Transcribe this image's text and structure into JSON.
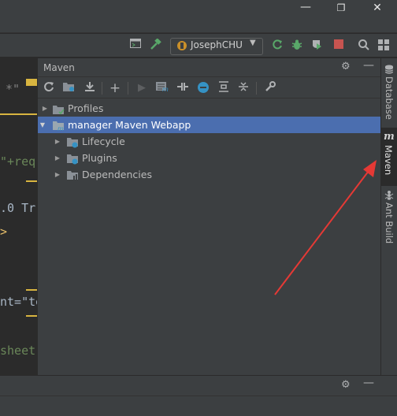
{
  "window": {
    "minimize_icon": "minimize-icon",
    "maximize_icon": "restore-icon",
    "close_icon": "close-icon"
  },
  "toolbar": {
    "run_config": "JosephCHU",
    "icons": [
      "project-structure-icon",
      "build-hammer-icon",
      "run-icon",
      "debug-icon",
      "coverage-icon",
      "stop-icon",
      "search-icon",
      "layout-icon"
    ],
    "colors": {
      "run": "#59a869",
      "debug": "#59a869",
      "stop": "#c75450",
      "hammer": "#59a869"
    }
  },
  "editor": {
    "lines": [
      {
        "text": "*\""
      },
      {
        "text": "\"+req"
      },
      {
        "text": ".0 Tr"
      },
      {
        "text": ">"
      },
      {
        "text": "nt=\"te"
      },
      {
        "text": "sheet\""
      }
    ]
  },
  "maven": {
    "title": "Maven",
    "tree": [
      {
        "label": "Profiles",
        "level": 0,
        "expanded": false,
        "selected": false
      },
      {
        "label": "manager Maven Webapp",
        "level": 0,
        "expanded": true,
        "selected": true
      },
      {
        "label": "Lifecycle",
        "level": 1,
        "expanded": false,
        "selected": false
      },
      {
        "label": "Plugins",
        "level": 1,
        "expanded": false,
        "selected": false
      },
      {
        "label": "Dependencies",
        "level": 1,
        "expanded": false,
        "selected": false
      }
    ]
  },
  "right_strip": {
    "tabs": [
      {
        "label": "Database",
        "active": false
      },
      {
        "label": "Maven",
        "active": true
      },
      {
        "label": "Ant Build",
        "active": false
      }
    ]
  },
  "colors": {
    "selection": "#4b6eaf",
    "annotation_arrow": "#e53935"
  }
}
